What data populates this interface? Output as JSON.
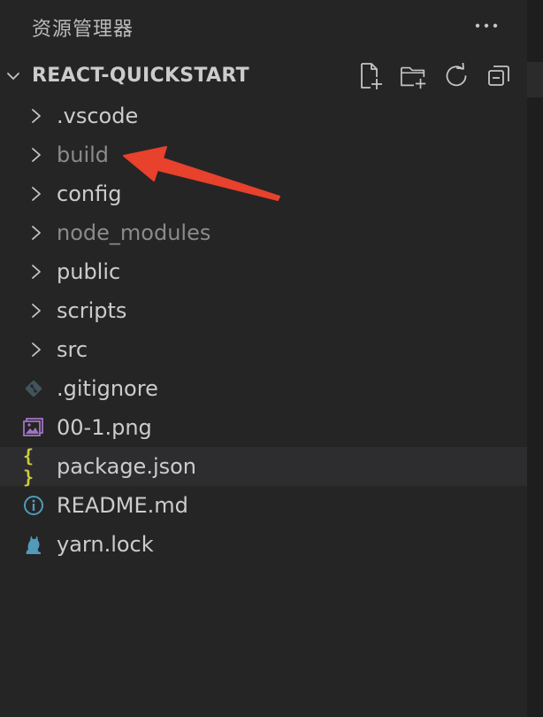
{
  "header": {
    "title": "资源管理器",
    "more_icon": "ellipsis-icon"
  },
  "section": {
    "title": "REACT-QUICKSTART",
    "actions": [
      {
        "name": "new-file-button",
        "icon": "new-file-icon"
      },
      {
        "name": "new-folder-button",
        "icon": "new-folder-icon"
      },
      {
        "name": "refresh-button",
        "icon": "refresh-icon"
      },
      {
        "name": "collapse-all-button",
        "icon": "collapse-all-icon"
      }
    ]
  },
  "tree": [
    {
      "label": ".vscode",
      "type": "folder",
      "dim": false
    },
    {
      "label": "build",
      "type": "folder",
      "dim": true
    },
    {
      "label": "config",
      "type": "folder",
      "dim": false
    },
    {
      "label": "node_modules",
      "type": "folder",
      "dim": true
    },
    {
      "label": "public",
      "type": "folder",
      "dim": false
    },
    {
      "label": "scripts",
      "type": "folder",
      "dim": false
    },
    {
      "label": "src",
      "type": "folder",
      "dim": false
    },
    {
      "label": ".gitignore",
      "type": "file",
      "icon": "git-icon",
      "dim": false
    },
    {
      "label": "00-1.png",
      "type": "file",
      "icon": "image-file-icon",
      "dim": false
    },
    {
      "label": "package.json",
      "type": "file",
      "icon": "json-braces-icon",
      "dim": false,
      "selected": true
    },
    {
      "label": "README.md",
      "type": "file",
      "icon": "info-icon",
      "dim": false
    },
    {
      "label": "yarn.lock",
      "type": "file",
      "icon": "yarn-cat-icon",
      "dim": false
    }
  ],
  "colors": {
    "background": "#252526",
    "text": "#cccccc",
    "dim_text": "#8b8b8b",
    "selected_row": "#2d2d2f",
    "annotation_arrow": "#e8412c",
    "json_icon": "#cbcb41",
    "info_icon": "#519aba",
    "image_icon": "#a074c4",
    "git_icon": "#41535b"
  },
  "annotation": {
    "type": "arrow",
    "points_to": "build"
  }
}
